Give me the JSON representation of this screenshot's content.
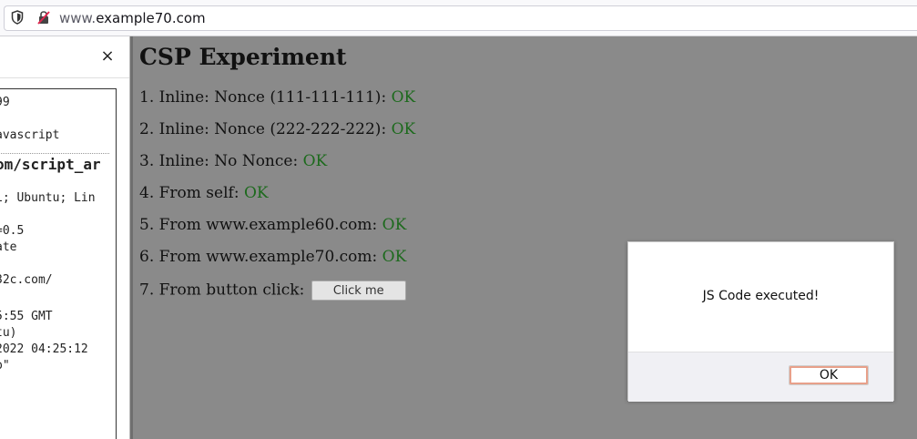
{
  "browser": {
    "url_prefix": "www.",
    "url_domain": "example70.com",
    "icons": {
      "security": "shield-icon",
      "insecure": "insecure-lock-icon"
    }
  },
  "devpanel": {
    "close_label": "×",
    "lines": [
      "99",
      "avascript",
      "om/script_ar",
      "1; Ubuntu; Lin",
      "=0.5",
      "ate",
      "32c.com/",
      "5:55 GMT",
      "tu)",
      "2022 04:25:12",
      "p\""
    ]
  },
  "page": {
    "title": "CSP Experiment",
    "tests": [
      {
        "label": "1. Inline: Nonce (111-111-111): ",
        "status": "OK"
      },
      {
        "label": "2. Inline: Nonce (222-222-222): ",
        "status": "OK"
      },
      {
        "label": "3. Inline: No Nonce: ",
        "status": "OK"
      },
      {
        "label": "4. From self: ",
        "status": "OK"
      },
      {
        "label": "5. From www.example60.com: ",
        "status": "OK"
      },
      {
        "label": "6. From www.example70.com: ",
        "status": "OK"
      }
    ],
    "button_test": {
      "label": "7. From button click: ",
      "button_label": "Click me"
    },
    "ok_color": "#1d6a1d"
  },
  "dialog": {
    "message": "JS Code executed!",
    "ok_label": "OK"
  }
}
